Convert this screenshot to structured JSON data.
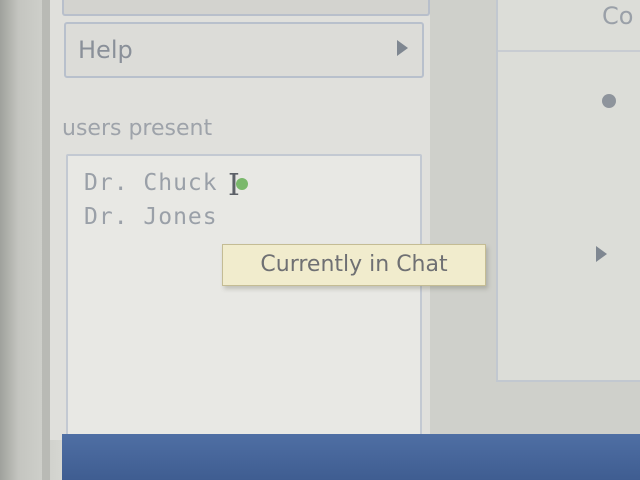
{
  "menu": {
    "help_label": "Help"
  },
  "users": {
    "heading": "users present",
    "list": [
      "Dr. Chuck",
      "Dr. Jones"
    ]
  },
  "tooltip": {
    "text": "Currently in Chat"
  },
  "right_panel": {
    "label": "Co"
  },
  "colors": {
    "accent_bar": "#3f5d91",
    "online_status": "#7ab86b",
    "tooltip_bg": "#f1eccd"
  }
}
